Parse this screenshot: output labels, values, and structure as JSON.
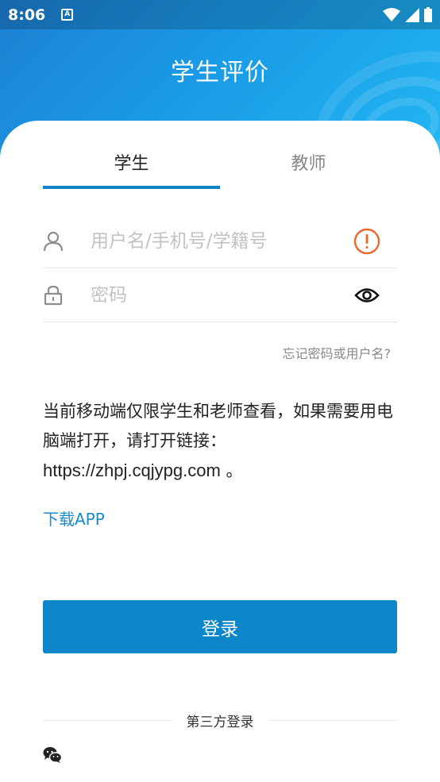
{
  "status_bar": {
    "time": "8:06",
    "badge": "A",
    "icons": [
      "wifi-icon",
      "signal-icon",
      "battery-icon"
    ]
  },
  "header": {
    "title": "学生评价"
  },
  "tabs": [
    {
      "label": "学生",
      "active": true
    },
    {
      "label": "教师",
      "active": false
    }
  ],
  "form": {
    "username_placeholder": "用户名/手机号/学籍号",
    "username_value": "",
    "password_placeholder": "密码",
    "password_value": "",
    "username_warning_icon": "alert-circle-icon",
    "password_toggle_icon": "eye-icon"
  },
  "links": {
    "forgot": "忘记密码或用户名?",
    "download": "下载APP"
  },
  "notice": {
    "text": "当前移动端仅限学生和老师查看，如果需要用电脑端打开，请打开链接：",
    "url": "https://zhpj.cqjypg.com",
    "suffix": " 。"
  },
  "login_button": "登录",
  "third_party": {
    "label": "第三方登录",
    "icons": [
      "wechat-icon"
    ]
  },
  "colors": {
    "primary": "#0b86c9",
    "header_start": "#1d7fd2",
    "header_end": "#22b6f2",
    "warning": "#e8692a",
    "link": "#1a8bd0"
  }
}
